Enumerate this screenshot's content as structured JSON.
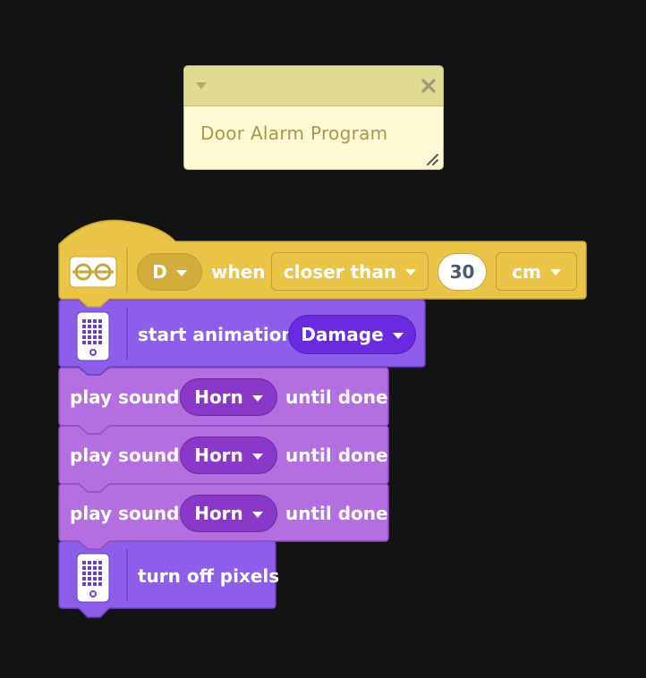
{
  "note": {
    "text": "Door Alarm Program",
    "collapse_icon": "chevron-down-icon",
    "close_icon": "close-icon",
    "resize_icon": "resize-grip-icon"
  },
  "hat_block": {
    "icon": "distance-sensor-icon",
    "port": "D",
    "when_label": "when",
    "comparison": "closer than",
    "distance": "30",
    "unit": "cm"
  },
  "animation_block": {
    "icon": "light-matrix-icon",
    "label": "start animation",
    "animation": "Damage"
  },
  "sound_blocks": [
    {
      "label": "play sound",
      "sound": "Horn",
      "suffix": "until done"
    },
    {
      "label": "play sound",
      "sound": "Horn",
      "suffix": "until done"
    },
    {
      "label": "play sound",
      "sound": "Horn",
      "suffix": "until done"
    }
  ],
  "pixels_block": {
    "icon": "light-matrix-icon",
    "label": "turn off pixels"
  },
  "colors": {
    "background": "#141313",
    "event_yellow": "#e9c447",
    "light_purple": "#a469d5",
    "matrix_purple": "#8c5ee9",
    "sound_pill": "#8a38c7",
    "animation_pill": "#6a2be0"
  }
}
